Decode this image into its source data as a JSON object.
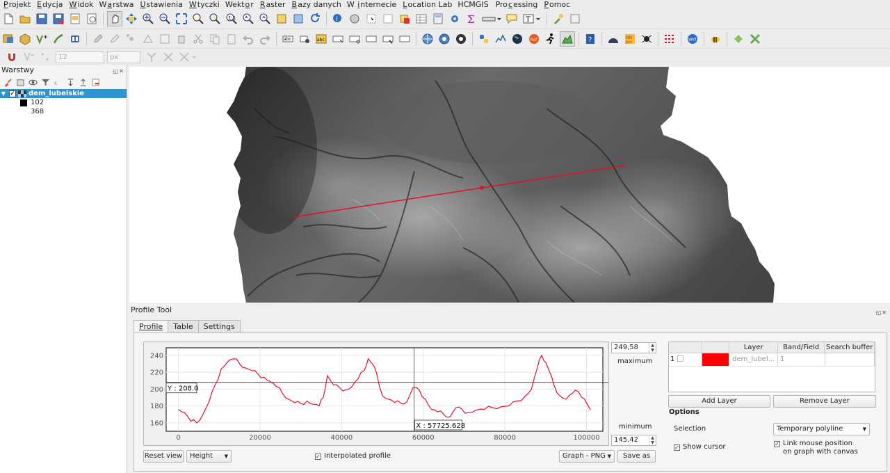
{
  "menu": {
    "items": [
      {
        "pre": "",
        "u": "P",
        "post": "rojekt"
      },
      {
        "pre": "",
        "u": "E",
        "post": "dycja"
      },
      {
        "pre": "",
        "u": "W",
        "post": "idok"
      },
      {
        "pre": "W",
        "u": "a",
        "post": "rstwa"
      },
      {
        "pre": "",
        "u": "U",
        "post": "stawienia"
      },
      {
        "pre": "",
        "u": "W",
        "post": "tyczki"
      },
      {
        "pre": "Wekt",
        "u": "o",
        "post": "r"
      },
      {
        "pre": "",
        "u": "R",
        "post": "aster"
      },
      {
        "pre": "",
        "u": "B",
        "post": "azy danych"
      },
      {
        "pre": "W ",
        "u": "i",
        "post": "nternecie"
      },
      {
        "pre": "",
        "u": "L",
        "post": "ocation Lab"
      },
      {
        "pre": "HCMGIS",
        "u": "",
        "post": ""
      },
      {
        "pre": "Pro",
        "u": "c",
        "post": "essing"
      },
      {
        "pre": "",
        "u": "P",
        "post": "omoc"
      }
    ]
  },
  "digitize_toolbar": {
    "size_value": "12",
    "unit_value": "px"
  },
  "layers_panel": {
    "title": "Warstwy",
    "layer_name": "dem_lubelskie",
    "legend": [
      {
        "label": "102",
        "color": "#000000"
      },
      {
        "label": "368",
        "color": "#ffffff"
      }
    ]
  },
  "profile_tool": {
    "title": "Profile Tool",
    "tabs": [
      {
        "label": "Profile",
        "active": true
      },
      {
        "label": "Table",
        "active": false
      },
      {
        "label": "Settings",
        "active": false
      }
    ],
    "max_value": "249,58",
    "max_label": "maximum",
    "min_value": "145,42",
    "min_label": "minimum",
    "reset_view_label": "Reset view",
    "mode_value": "Height",
    "interpolated_label": "Interpolated profile",
    "export_format": "Graph - PNG",
    "save_as_label": "Save as",
    "cursor_y_label": "Y : 208.0",
    "cursor_x_label": "X : 57725.628",
    "layer_table": {
      "headers": [
        "",
        "",
        "Layer",
        "Band/Field",
        "Search buffer"
      ],
      "rows": [
        {
          "index": "1",
          "color": "#ff0000",
          "layer": "dem_lubel...",
          "band": "1",
          "buffer": ""
        }
      ]
    },
    "add_layer_label": "Add Layer",
    "remove_layer_label": "Remove Layer",
    "options_label": "Options",
    "selection_label": "Selection",
    "selection_value": "Temporary polyline",
    "show_cursor_label": "Show cursor",
    "link_mouse_label_1": "Link mouse position",
    "link_mouse_label_2": "on graph with canvas"
  },
  "chart_data": {
    "type": "line",
    "xlabel": "",
    "ylabel": "",
    "xlim": [
      -3000,
      104000
    ],
    "ylim": [
      150,
      249
    ],
    "xticks": [
      0,
      20000,
      40000,
      60000,
      80000,
      100000
    ],
    "yticks": [
      160,
      180,
      200,
      220,
      240
    ],
    "grid": true,
    "cursor": {
      "x": 57725.628,
      "y": 208.0
    },
    "series": [
      {
        "color": "#e0102a",
        "x": [
          0,
          1500,
          3000,
          4500,
          6000,
          7500,
          9000,
          10500,
          12000,
          13500,
          15000,
          16500,
          18000,
          19500,
          21000,
          22500,
          24000,
          25500,
          27000,
          28500,
          30000,
          31500,
          33000,
          34500,
          35500,
          36500,
          38000,
          39500,
          41000,
          42500,
          44000,
          45500,
          46500,
          47500,
          48500,
          50000,
          51500,
          53000,
          54500,
          56000,
          57500,
          59000,
          60500,
          62000,
          63500,
          65000,
          66500,
          68000,
          69500,
          71000,
          73000,
          75000,
          77000,
          79000,
          81000,
          83000,
          85000,
          86500,
          88000,
          89000,
          90000,
          91000,
          92000,
          93500,
          95000,
          96500,
          98000,
          99500,
          101000
        ],
        "y": [
          176,
          172,
          162,
          160,
          170,
          185,
          205,
          224,
          232,
          236,
          230,
          225,
          222,
          218,
          214,
          209,
          203,
          195,
          188,
          184,
          183,
          186,
          182,
          180,
          190,
          216,
          205,
          202,
          199,
          203,
          212,
          222,
          236,
          230,
          220,
          192,
          188,
          184,
          183,
          185,
          202,
          199,
          188,
          176,
          173,
          170,
          167,
          178,
          176,
          172,
          175,
          176,
          178,
          179,
          180,
          186,
          192,
          200,
          226,
          240,
          232,
          220,
          205,
          192,
          188,
          195,
          197,
          188,
          175
        ]
      }
    ]
  }
}
